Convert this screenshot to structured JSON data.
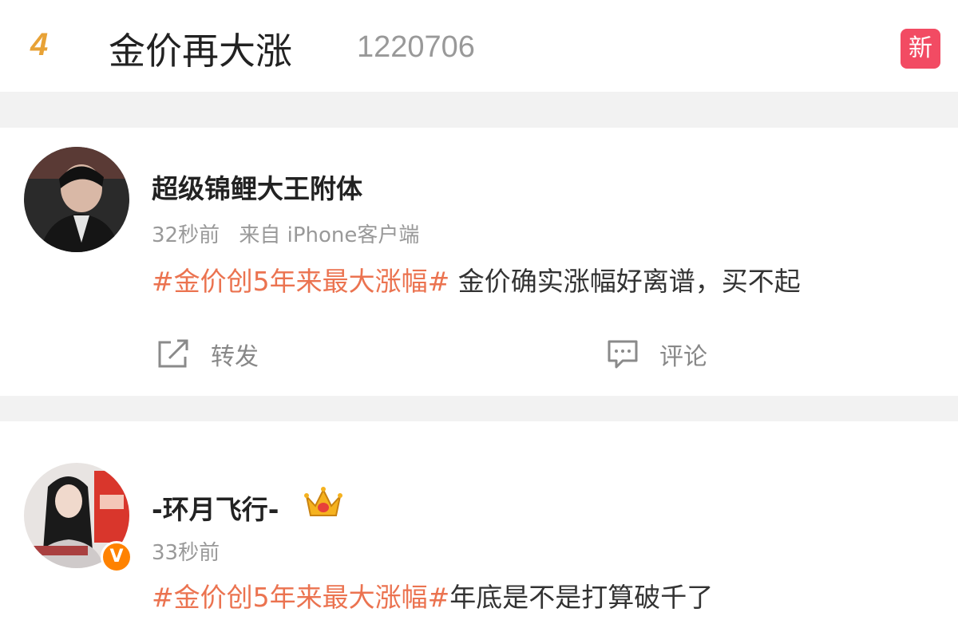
{
  "topic": {
    "rank": "4",
    "title": "金价再大涨",
    "heat": "1220706",
    "badge": "新"
  },
  "posts": [
    {
      "username": "超级锦鲤大王附体",
      "time": "32秒前",
      "source": "来自 iPhone客户端",
      "hashtag": "#金价创5年来最大涨幅#",
      "text": " 金价确实涨幅好离谱，买不起",
      "actions": {
        "repost": "转发",
        "comment": "评论"
      }
    },
    {
      "username": "-环月飞行-",
      "time": "33秒前",
      "hashtag": "#金价创5年来最大涨幅#",
      "text": "年底是不是打算破千了",
      "verified_badge": "V"
    }
  ],
  "colors": {
    "hashtag": "#eb7350",
    "new_badge": "#f24b63",
    "rank": "#e8a236",
    "verified": "#ff8200"
  }
}
